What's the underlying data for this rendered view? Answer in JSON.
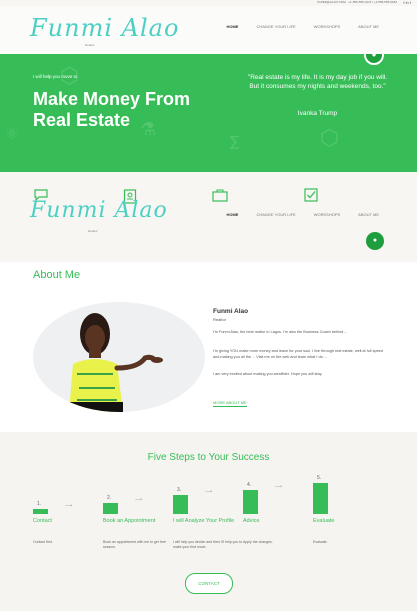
{
  "topbar": {
    "email": "FUNMI@ALAO.COM",
    "phone": "+1-555-555-0147 / +1-555-555-0182",
    "social": [
      "f",
      "in",
      "t"
    ]
  },
  "header": {
    "logo": "Funmi Alao",
    "logo_sub": "Realtor",
    "nav": [
      "HOME",
      "CHANGE YOUR LIFE",
      "WORKSHOPS",
      "ABOUT ME"
    ]
  },
  "hero": {
    "intro": "I will help you move to",
    "title": "Make Money From Real Estate",
    "quote": "\"Real estate is my life. It is my day job if you will. But it consumes my nights and weekends, too.\"",
    "author": "Ivanka Trump"
  },
  "about": {
    "heading": "About Me",
    "name": "Funmi Alao",
    "role": "Realtor",
    "para1": "I'm Funmi Alao, the best realtor in Lagos. I'm also the Business Coach behind ...",
    "para2": "I'm giving YOU make more money and leave for your soul. I live through real estate, well at full speed and making you all the ... Visit me on the web and learn what I do ...",
    "para3": "I am very excited about making you wealthier. Hope you will stay.",
    "button": "MORE ABOUT ME"
  },
  "steps": {
    "heading": "Five Steps to Your Success",
    "items": [
      {
        "num": "1.",
        "label": "Contact",
        "desc": "Contact first.",
        "level": 0.15
      },
      {
        "num": "2.",
        "label": "Book an Appointment",
        "desc": "Book an appointment with me to get free session.",
        "level": 0.35
      },
      {
        "num": "3.",
        "label": "I will Analyze Your Profile",
        "desc": "I will help you decide and then I'll help you to make your first move.",
        "level": 0.6
      },
      {
        "num": "4.",
        "label": "Advice",
        "desc": "Apply the changes.",
        "level": 0.78
      },
      {
        "num": "5.",
        "label": "Evaluate",
        "desc": "Evaluate.",
        "level": 1.0
      }
    ],
    "contact_button": "CONTACT"
  },
  "colors": {
    "accent": "#37bd57",
    "logo": "#4dd0c4"
  }
}
